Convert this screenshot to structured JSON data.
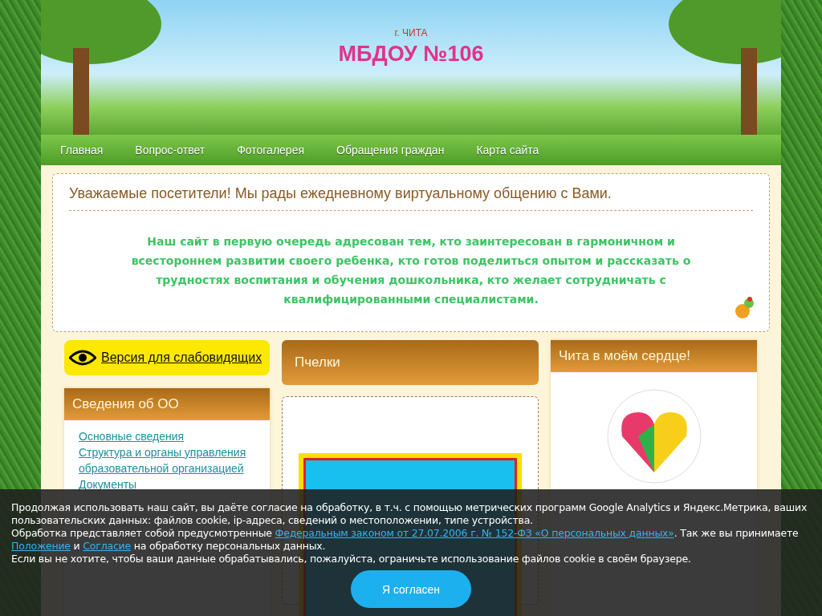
{
  "header": {
    "city": "г. ЧИТА",
    "title": "МБДОУ №106"
  },
  "nav": [
    "Главная",
    "Вопрос-ответ",
    "Фотогалерея",
    "Обращения граждан",
    "Карта сайта"
  ],
  "welcome": {
    "heading": "Уважаемые посетители! Мы рады ежедневному виртуальному общению с Вами.",
    "text": "Наш сайт в первую очередь адресован тем, кто заинтересован в гармоничном и всестороннем развитии своего ребенка, кто готов поделиться опытом и рассказать о трудностях воспитания и обучения дошкольника, кто желает сотрудничать с квалифицированными специалистами."
  },
  "accessibility_link": "Версия для слабовидящих",
  "left_panel": {
    "title": "Сведения об ОО",
    "links": [
      "Основные сведения",
      "Структура и органы управления образовательной организацией",
      "Документы"
    ]
  },
  "center_panel": {
    "title": "Пчелки"
  },
  "right_panels": [
    {
      "title": "Чита в моём сердце!",
      "kind": "heart"
    }
  ],
  "cookie_banner": {
    "paragraphs": [
      [
        {
          "text": "Продолжая использовать наш сайт, вы даёте согласие на обработку, в т.ч. с помощью метрических программ Google Analytics и Яндекс.Метрика, ваших пользовательских данных: файлов cookie, ip-адреса, сведений о местоположении, типе устройства.",
          "kind": "text"
        }
      ],
      [
        {
          "text": "Обработка представляет собой предусмотренные ",
          "kind": "text"
        },
        {
          "text": "Федеральным законом от 27.07.2006 г. № 152-ФЗ «О персональных данных»",
          "kind": "link"
        },
        {
          "text": ". Так же вы принимаете ",
          "kind": "text"
        },
        {
          "text": "Положение",
          "kind": "link"
        },
        {
          "text": " и ",
          "kind": "text"
        },
        {
          "text": "Согласие",
          "kind": "link"
        },
        {
          "text": " на обработку персональных данных.",
          "kind": "text"
        }
      ],
      [
        {
          "text": "Если вы не хотите, чтобы ваши данные обрабатывались, пожалуйста, ограничьте использование файлов cookie в своём браузере.",
          "kind": "text"
        }
      ]
    ],
    "button": "Я согласен"
  }
}
